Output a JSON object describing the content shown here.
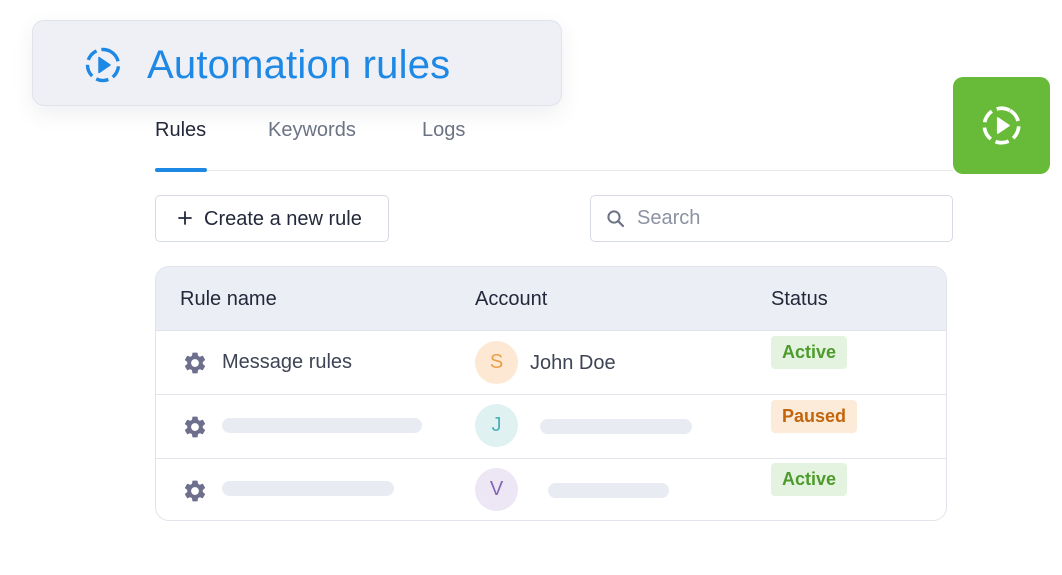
{
  "header": {
    "title": "Automation rules",
    "icon": "play-circle-dashed-icon",
    "accent": "#1e88e5"
  },
  "action_tile": {
    "icon": "play-circle-dashed-icon",
    "color": "#67bb38"
  },
  "tabs": [
    {
      "label": "Rules",
      "active": true
    },
    {
      "label": "Keywords",
      "active": false
    },
    {
      "label": "Logs",
      "active": false
    }
  ],
  "toolbar": {
    "create_label": "Create a new rule",
    "search_placeholder": "Search"
  },
  "table": {
    "headers": {
      "rule_name": "Rule name",
      "account": "Account",
      "status": "Status"
    },
    "rows": [
      {
        "name": "Message rules",
        "avatar_letter": "S",
        "account": "John Doe",
        "status": "Active"
      },
      {
        "name": "",
        "avatar_letter": "J",
        "account": "",
        "status": "Paused"
      },
      {
        "name": "",
        "avatar_letter": "V",
        "account": "",
        "status": "Active"
      }
    ]
  },
  "colors": {
    "active_bg": "#e3f3df",
    "active_text": "#4e9a2c",
    "paused_bg": "#fdebd9",
    "paused_text": "#c2650d",
    "avatar_s_bg": "#fde9d3",
    "avatar_s_text": "#e8a04a",
    "avatar_j_bg": "#e0f1f2",
    "avatar_j_text": "#4fb1b6",
    "avatar_v_bg": "#ece6f5",
    "avatar_v_text": "#8566b6"
  }
}
